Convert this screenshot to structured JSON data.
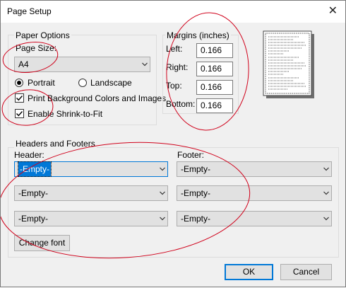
{
  "dialog": {
    "title": "Page Setup",
    "close_glyph": "✕"
  },
  "paper_options": {
    "legend": "Paper Options",
    "page_size_label": "Page Size:",
    "page_size_value": "A4",
    "portrait_label": "Portrait",
    "landscape_label": "Landscape",
    "orientation_selected": "Portrait",
    "print_bg_label": "Print Background Colors and Images",
    "print_bg_checked": true,
    "shrink_label": "Enable Shrink-to-Fit",
    "shrink_checked": true
  },
  "margins": {
    "legend": "Margins (inches)",
    "left_label": "Left:",
    "left_value": "0.166",
    "right_label": "Right:",
    "right_value": "0.166",
    "top_label": "Top:",
    "top_value": "0.166",
    "bottom_label": "Bottom:",
    "bottom_value": "0.166"
  },
  "headers_footers": {
    "legend": "Headers and Footers",
    "header_label": "Header:",
    "footer_label": "Footer:",
    "header_values": [
      "-Empty-",
      "-Empty-",
      "-Empty-"
    ],
    "footer_values": [
      "-Empty-",
      "-Empty-",
      "-Empty-"
    ],
    "change_font_label": "Change font"
  },
  "buttons": {
    "ok_label": "OK",
    "cancel_label": "Cancel"
  },
  "icons": {
    "dropdown": "chevron-down-icon",
    "close": "close-icon",
    "check": "check-icon"
  },
  "colors": {
    "accent": "#0078d7",
    "annotation": "#d0021b"
  }
}
